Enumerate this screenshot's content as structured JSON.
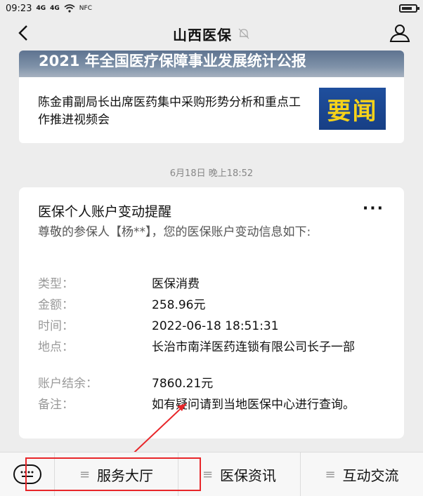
{
  "status_bar": {
    "time": "09:23",
    "signal1": "4G",
    "signal2": "4G",
    "nfc": "NFC"
  },
  "nav": {
    "title": "山西医保"
  },
  "news": {
    "banner": "2021 年全国医疗保障事业发展统计公报",
    "headline": "陈金甫副局长出席医药集中采购形势分析和重点工作推进视频会",
    "thumb_text": "要闻"
  },
  "timestamp": "6月18日 晚上18:52",
  "message": {
    "title": "医保个人账户变动提醒",
    "more": "···",
    "intro": "尊敬的参保人【杨**】，您的医保账户变动信息如下:",
    "fields": [
      {
        "label": "类型：",
        "value": "医保消费"
      },
      {
        "label": "金额：",
        "value": "258.96元"
      },
      {
        "label": "时间：",
        "value": "2022-06-18 18:51:31"
      },
      {
        "label": "地点：",
        "value": "长治市南洋医药连锁有限公司长子一部"
      },
      {
        "label": "账户结余：",
        "value": "7860.21元"
      },
      {
        "label": "备注：",
        "value": "如有疑问请到当地医保中心进行查询。"
      }
    ]
  },
  "bottom_menu": {
    "items": [
      {
        "label": "服务大厅"
      },
      {
        "label": "医保资讯"
      },
      {
        "label": "互动交流"
      }
    ]
  },
  "colors": {
    "annotation": "#e8262a",
    "background": "#ededed"
  }
}
